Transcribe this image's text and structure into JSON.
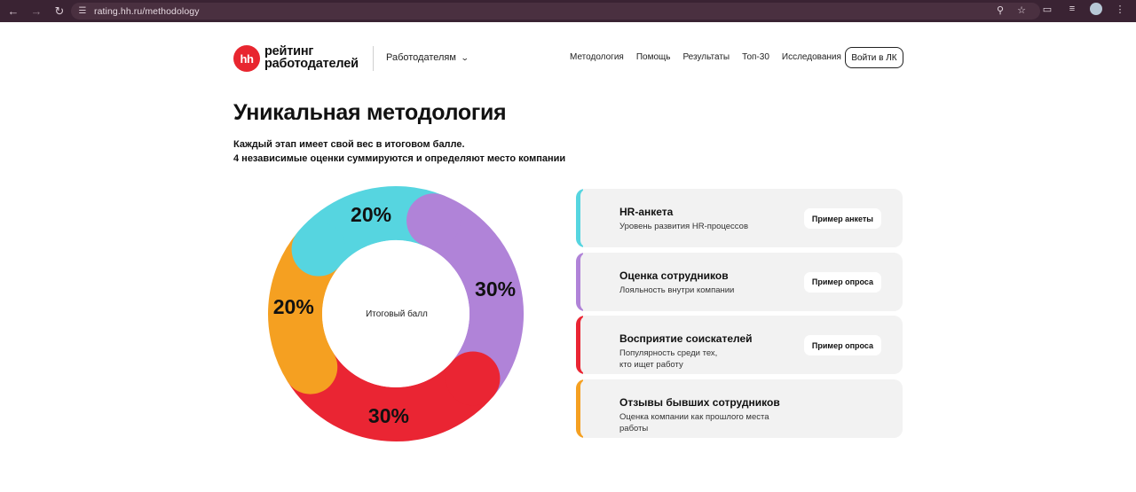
{
  "browser": {
    "url": "rating.hh.ru/methodology",
    "icons": {
      "back": "arrow-left-icon",
      "forward": "arrow-right-icon",
      "reload": "reload-icon",
      "site_info": "site-info-icon",
      "zoom": "zoom-icon",
      "bookmark": "star-icon",
      "extensions": "puzzle-icon",
      "media": "media-icon",
      "profile": "avatar"
    }
  },
  "header": {
    "logo_mark": "hh",
    "logo_line1": "рейтинг",
    "logo_line2": "работодателей",
    "audience_select": "Работодателям",
    "nav": [
      "Методология",
      "Помощь",
      "Результаты",
      "Топ-30",
      "Исследования"
    ],
    "login_label": "Войти в ЛК"
  },
  "main": {
    "title": "Уникальная методология",
    "subtitle_line1": "Каждый этап имеет свой вес в итоговом балле.",
    "subtitle_line2": "4 независимые оценки суммируются и определяют место компании"
  },
  "chart_data": {
    "type": "pie",
    "center_label": "Итоговый балл",
    "slices": [
      {
        "label": "20%",
        "value": 20,
        "color": "#56d5e0",
        "stage": "HR-анкета"
      },
      {
        "label": "30%",
        "value": 30,
        "color": "#b083d8",
        "stage": "Оценка сотрудников"
      },
      {
        "label": "30%",
        "value": 30,
        "color": "#ea2533",
        "stage": "Восприятие соискателей"
      },
      {
        "label": "20%",
        "value": 20,
        "color": "#f5a021",
        "stage": "Отзывы бывших сотрудников"
      }
    ]
  },
  "cards": [
    {
      "title": "HR-анкета",
      "desc": "Уровень развития HR-процессов",
      "button": "Пример анкеты",
      "color": "#56d5e0"
    },
    {
      "title": "Оценка сотрудников",
      "desc": "Лояльность внутри компании",
      "button": "Пример опроса",
      "color": "#b083d8"
    },
    {
      "title": "Восприятие соискателей",
      "desc_line1": "Популярность среди тех,",
      "desc_line2": "кто ищет работу",
      "button": "Пример опроса",
      "color": "#ea2533"
    },
    {
      "title": "Отзывы бывших сотрудников",
      "desc_line1": "Оценка компании как прошлого места",
      "desc_line2": "работы",
      "color": "#f5a021"
    }
  ]
}
